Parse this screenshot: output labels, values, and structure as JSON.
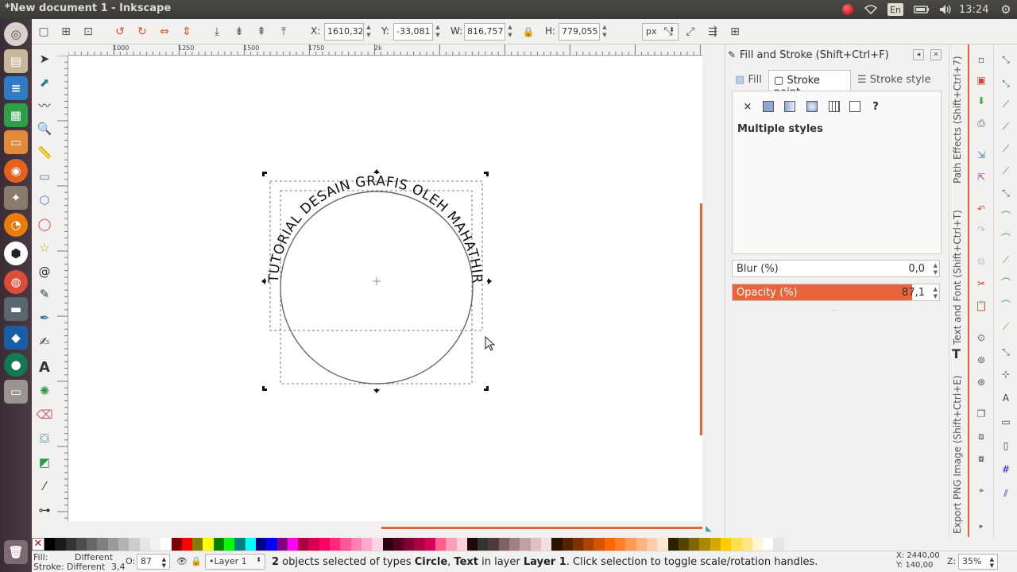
{
  "window": {
    "title": "*New document 1 - Inkscape"
  },
  "system_tray": {
    "keyboard": "En",
    "clock": "13:24"
  },
  "launcher": {
    "apps": [
      "dash-icon",
      "files-icon",
      "writer-icon",
      "calc-icon",
      "impress-icon",
      "firefox-icon",
      "gimp-icon",
      "blender-icon",
      "inkscape-icon",
      "chrome-icon",
      "scanner-icon",
      "app-icon",
      "browser-icon",
      "drive-icon"
    ]
  },
  "toolbar": {
    "x_label": "X:",
    "x_value": "1610,32",
    "y_label": "Y:",
    "y_value": "-33,081",
    "w_label": "W:",
    "w_value": "816,757",
    "h_label": "H:",
    "h_value": "779,055",
    "unit": "px"
  },
  "ruler": {
    "marks": [
      "1000",
      "1250",
      "1500",
      "1750",
      "2k"
    ]
  },
  "canvas": {
    "text_on_path": "TUTORIAL DESAIN GRAFIS OLEH MAHATHIR"
  },
  "dock": {
    "title": "Fill and Stroke (Shift+Ctrl+F)",
    "tabs": [
      "Fill",
      "Stroke paint",
      "Stroke style"
    ],
    "active_tab": "Stroke paint",
    "paint_none": "×",
    "paint_unknown": "?",
    "message": "Multiple styles",
    "blur_label": "Blur (%)",
    "blur_value": "0,0",
    "opacity_label": "Opacity (%)",
    "opacity_value": "87,1",
    "opacity_fraction": 0.871
  },
  "side_tabs": {
    "path_effects": "Path Effects  (Shift+Ctrl+7)",
    "text_font": "Text and Font (Shift+Ctrl+T)",
    "export": "Export PNG Image (Shift+Ctrl+E)"
  },
  "statusbar": {
    "fill_label": "Fill:",
    "fill_value": "Different",
    "stroke_label": "Stroke:",
    "stroke_value": "Different",
    "stroke_width": "3,4",
    "opacity_label": "O:",
    "opacity_value": "87",
    "layer": "•Layer 1",
    "msg_1": "2",
    "msg_2": " objects selected of types ",
    "msg_3": "Circle",
    "msg_4": ", ",
    "msg_5": "Text",
    "msg_6": " in layer ",
    "msg_7": "Layer 1",
    "msg_8": ". Click selection to toggle scale/rotation handles.",
    "cursor_x": "X: 2440,00",
    "cursor_y": "Y:  140,00",
    "zoom_label": "Z:",
    "zoom": "35%"
  },
  "palette": {
    "colors": [
      "#000000",
      "#1a1a1a",
      "#333333",
      "#4d4d4d",
      "#666666",
      "#808080",
      "#999999",
      "#b3b3b3",
      "#cccccc",
      "#e6e6e6",
      "#f2f2f2",
      "#ffffff",
      "#800000",
      "#ff0000",
      "#808000",
      "#ffff00",
      "#008000",
      "#00ff00",
      "#008080",
      "#00ffff",
      "#000080",
      "#0000ff",
      "#800080",
      "#ff00ff",
      "#aa0044",
      "#d40055",
      "#ff0066",
      "#ff2a7f",
      "#ff5599",
      "#ff80b2",
      "#ffaacc",
      "#ffd5e5",
      "#2b0011",
      "#550022",
      "#800033",
      "#aa0044",
      "#d4005a",
      "#ff5f8d",
      "#ff9eb9",
      "#ffcfdc",
      "#1a0a0a",
      "#333333",
      "#4d3a3a",
      "#806060",
      "#a08080",
      "#c0a0a0",
      "#e0c0c0",
      "#f0e0e0",
      "#2b1100",
      "#552200",
      "#803300",
      "#aa4400",
      "#d45500",
      "#ff6600",
      "#ff7f2a",
      "#ff9955",
      "#ffb380",
      "#ffccaa",
      "#ffe6d5",
      "#2b2200",
      "#554400",
      "#806600",
      "#aa8800",
      "#d4aa00",
      "#ffcc00",
      "#ffdd55",
      "#ffe680",
      "#fff6d5",
      "#ffffff",
      "#e6e6e6"
    ]
  }
}
